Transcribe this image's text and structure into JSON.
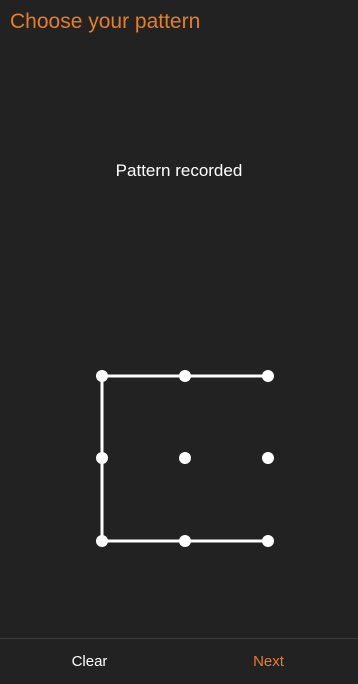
{
  "header": {
    "title": "Choose your pattern",
    "title_color": "#e67e22"
  },
  "status": {
    "text": "Pattern recorded"
  },
  "pattern": {
    "grid_size": 3,
    "selected_sequence": [
      2,
      1,
      0,
      3,
      6,
      7,
      8
    ],
    "line_color": "#ffffff",
    "dot_color": "#ffffff"
  },
  "footer": {
    "clear_label": "Clear",
    "next_label": "Next",
    "next_color": "#e67e22"
  }
}
